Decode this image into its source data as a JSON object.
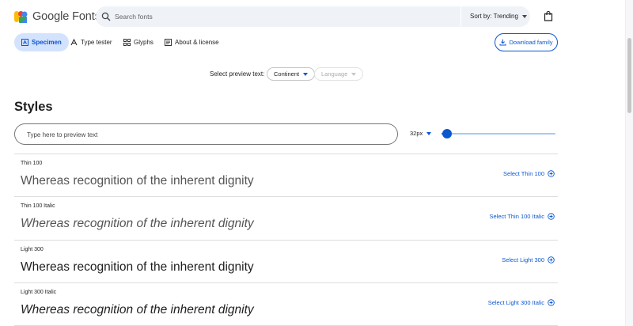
{
  "header": {
    "logo_text": "Google Fonts",
    "search_placeholder": "Search fonts",
    "sort_label": "Sort by: Trending",
    "brand_colors": [
      "#4285f4",
      "#ea4335",
      "#fbbc04",
      "#34a853"
    ]
  },
  "tabs": [
    {
      "label": "Specimen",
      "icon": "specimen-icon",
      "active": true
    },
    {
      "label": "Type tester",
      "icon": "type-tester-icon",
      "active": false
    },
    {
      "label": "Glyphs",
      "icon": "glyphs-icon",
      "active": false
    },
    {
      "label": "About & license",
      "icon": "about-icon",
      "active": false
    }
  ],
  "download_label": "Download family",
  "preview": {
    "label": "Select preview text:",
    "option_selected": "Continent",
    "language_placeholder": "Language"
  },
  "styles": {
    "heading": "Styles",
    "input_placeholder": "Type here to preview text",
    "size_label": "32px",
    "slider_fraction": 0.05
  },
  "rows": [
    {
      "name": "Thin 100",
      "sample": "Whereas recognition of the inherent dignity",
      "select": "Select Thin 100",
      "weight": 100,
      "italic": false
    },
    {
      "name": "Thin 100 Italic",
      "sample": "Whereas recognition of the inherent dignity",
      "select": "Select Thin 100 Italic",
      "weight": 100,
      "italic": true
    },
    {
      "name": "Light 300",
      "sample": "Whereas recognition of the inherent dignity",
      "select": "Select Light 300",
      "weight": 300,
      "italic": false
    },
    {
      "name": "Light 300 Italic",
      "sample": "Whereas recognition of the inherent dignity",
      "select": "Select Light 300 Italic",
      "weight": 300,
      "italic": true
    }
  ],
  "colors": {
    "accent": "#0b57d0",
    "active_tab_bg": "#d3e3fd",
    "search_bg": "#eff3f8"
  }
}
